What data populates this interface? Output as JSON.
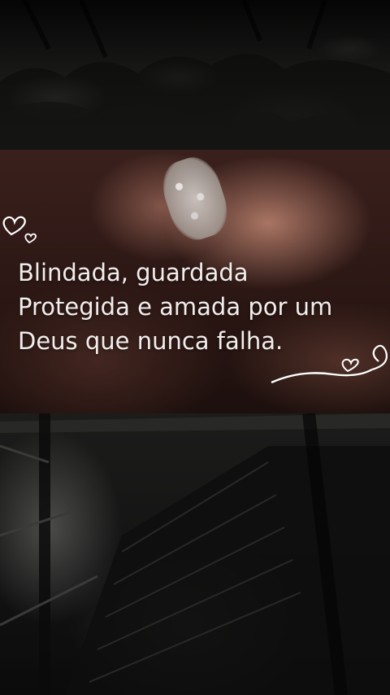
{
  "verse": {
    "line1": "Blindada, guardada",
    "line2": "Protegida e amada por um",
    "line3": "Deus que nunca falha."
  },
  "colors": {
    "text": "#f2eeec",
    "decoration": "#ffffff"
  },
  "icons": [
    "heart-icon",
    "swirl-heart-icon"
  ]
}
